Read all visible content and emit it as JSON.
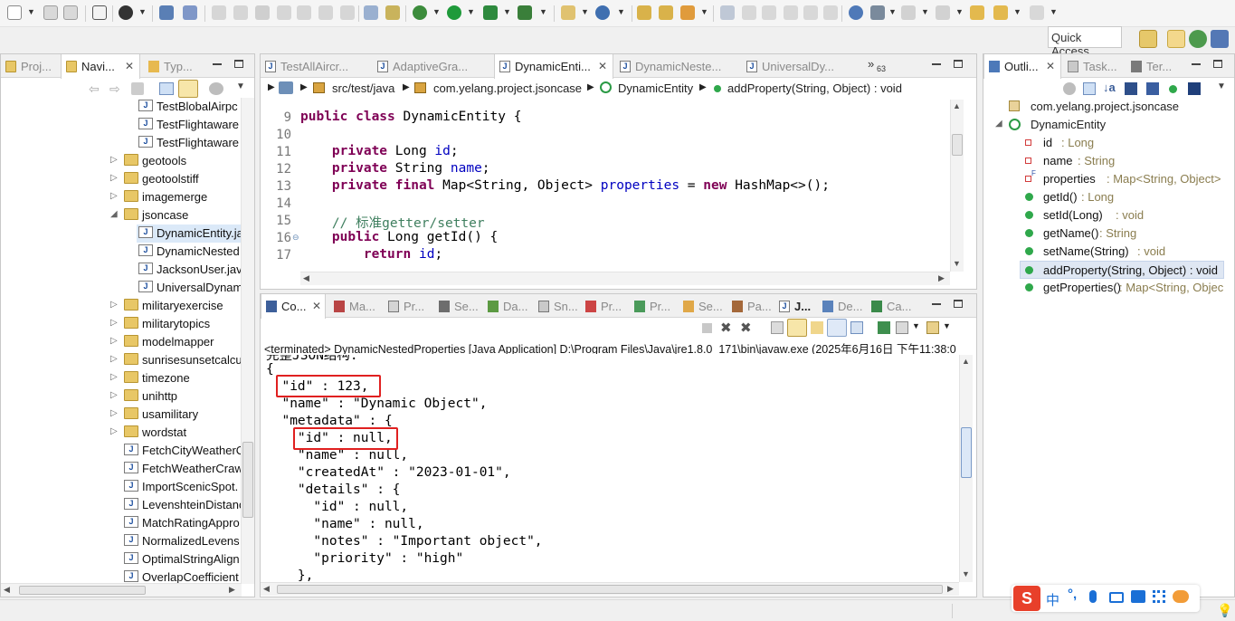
{
  "toolbar": {
    "quick_access": "Quick Access"
  },
  "navigator": {
    "tabs": [
      {
        "label": "Proj..."
      },
      {
        "label": "Navi..."
      },
      {
        "label": "Typ..."
      }
    ],
    "items": [
      {
        "label": "TestBlobalAirpc",
        "type": "java"
      },
      {
        "label": "TestFlightaware",
        "type": "java"
      },
      {
        "label": "TestFlightaware",
        "type": "java"
      },
      {
        "label": "geotools",
        "type": "folder"
      },
      {
        "label": "geotoolstiff",
        "type": "folder"
      },
      {
        "label": "imagemerge",
        "type": "folder"
      },
      {
        "label": "jsoncase",
        "type": "folder-open"
      },
      {
        "label": "DynamicEntity.ja",
        "type": "java"
      },
      {
        "label": "DynamicNested",
        "type": "java"
      },
      {
        "label": "JacksonUser.jav",
        "type": "java"
      },
      {
        "label": "UniversalDynam",
        "type": "java"
      },
      {
        "label": "militaryexercise",
        "type": "folder"
      },
      {
        "label": "militarytopics",
        "type": "folder"
      },
      {
        "label": "modelmapper",
        "type": "folder"
      },
      {
        "label": "sunrisesunsetcalcu",
        "type": "folder"
      },
      {
        "label": "timezone",
        "type": "folder"
      },
      {
        "label": "unihttp",
        "type": "folder"
      },
      {
        "label": "usamilitary",
        "type": "folder"
      },
      {
        "label": "wordstat",
        "type": "folder"
      },
      {
        "label": "FetchCityWeatherC",
        "type": "java"
      },
      {
        "label": "FetchWeatherCraw",
        "type": "java"
      },
      {
        "label": "ImportScenicSpot.",
        "type": "java"
      },
      {
        "label": "LevenshteinDistanc",
        "type": "java"
      },
      {
        "label": "MatchRatingAppro",
        "type": "java"
      },
      {
        "label": "NormalizedLevens",
        "type": "java"
      },
      {
        "label": "OptimalStringAlign",
        "type": "java"
      },
      {
        "label": "OverlapCoefficient",
        "type": "java"
      }
    ]
  },
  "editor": {
    "tabs": [
      {
        "label": "TestAllAircr..."
      },
      {
        "label": "AdaptiveGra..."
      },
      {
        "label": "DynamicEnti..."
      },
      {
        "label": "DynamicNeste..."
      },
      {
        "label": "UniversalDy..."
      }
    ],
    "overflow_count": "63",
    "breadcrumb": {
      "source_folder": "src/test/java",
      "package": "com.yelang.project.jsoncase",
      "class": "DynamicEntity",
      "method": "addProperty(String, Object) : void"
    },
    "lines": [
      {
        "num": "9",
        "text": "public class DynamicEntity {"
      },
      {
        "num": "10",
        "text": ""
      },
      {
        "num": "11",
        "text": "    private Long id;"
      },
      {
        "num": "12",
        "text": "    private String name;"
      },
      {
        "num": "13",
        "text": "    private final Map<String, Object> properties = new HashMap<>();"
      },
      {
        "num": "14",
        "text": ""
      },
      {
        "num": "15",
        "text": "    // 标准getter/setter"
      },
      {
        "num": "16",
        "text": "    public Long getId() {"
      },
      {
        "num": "17",
        "text": "        return id;"
      }
    ]
  },
  "console": {
    "tabs": [
      {
        "label": "Co..."
      },
      {
        "label": "Ma..."
      },
      {
        "label": "Pr..."
      },
      {
        "label": "Se..."
      },
      {
        "label": "Da..."
      },
      {
        "label": "Sn..."
      },
      {
        "label": "Pr..."
      },
      {
        "label": "Pr..."
      },
      {
        "label": "Se..."
      },
      {
        "label": "Pa..."
      },
      {
        "label": "J..."
      },
      {
        "label": "De..."
      },
      {
        "label": "Ca..."
      }
    ],
    "status_line": "<terminated> DynamicNestedProperties [Java Application] D:\\Program Files\\Java\\jre1.8.0_171\\bin\\javaw.exe (2025年6月16日 下午11:38:0",
    "output": [
      "完整JSON结构:",
      "{",
      "  \"id\" : 123,",
      "  \"name\" : \"Dynamic Object\",",
      "  \"metadata\" : {",
      "    \"id\" : null,",
      "    \"name\" : null,",
      "    \"createdAt\" : \"2023-01-01\",",
      "    \"details\" : {",
      "      \"id\" : null,",
      "      \"name\" : null,",
      "      \"notes\" : \"Important object\",",
      "      \"priority\" : \"high\"",
      "    },"
    ]
  },
  "outline": {
    "tabs": [
      {
        "label": "Outli..."
      },
      {
        "label": "Task..."
      },
      {
        "label": "Ter..."
      }
    ],
    "package": "com.yelang.project.jsoncase",
    "class": "DynamicEntity",
    "members": [
      {
        "name": "id",
        "type": " : Long",
        "kind": "field"
      },
      {
        "name": "name",
        "type": " : String",
        "kind": "field"
      },
      {
        "name": "properties",
        "type": " : Map<String, Object>",
        "kind": "field-final"
      },
      {
        "name": "getId()",
        "type": " : Long",
        "kind": "method"
      },
      {
        "name": "setId(Long)",
        "type": " : void",
        "kind": "method"
      },
      {
        "name": "getName()",
        "type": " : String",
        "kind": "method"
      },
      {
        "name": "setName(String)",
        "type": " : void",
        "kind": "method"
      },
      {
        "name": "addProperty(String, Object) : void",
        "type": "",
        "kind": "method"
      },
      {
        "name": "getProperties()",
        "type": " : Map<String, Objec",
        "kind": "method"
      }
    ]
  },
  "ime": {
    "mode": "中"
  },
  "colors": {
    "keyword": "#7f0055",
    "field": "#0000c0",
    "comment": "#3f7f5f",
    "highlight_box": "#e02020"
  }
}
